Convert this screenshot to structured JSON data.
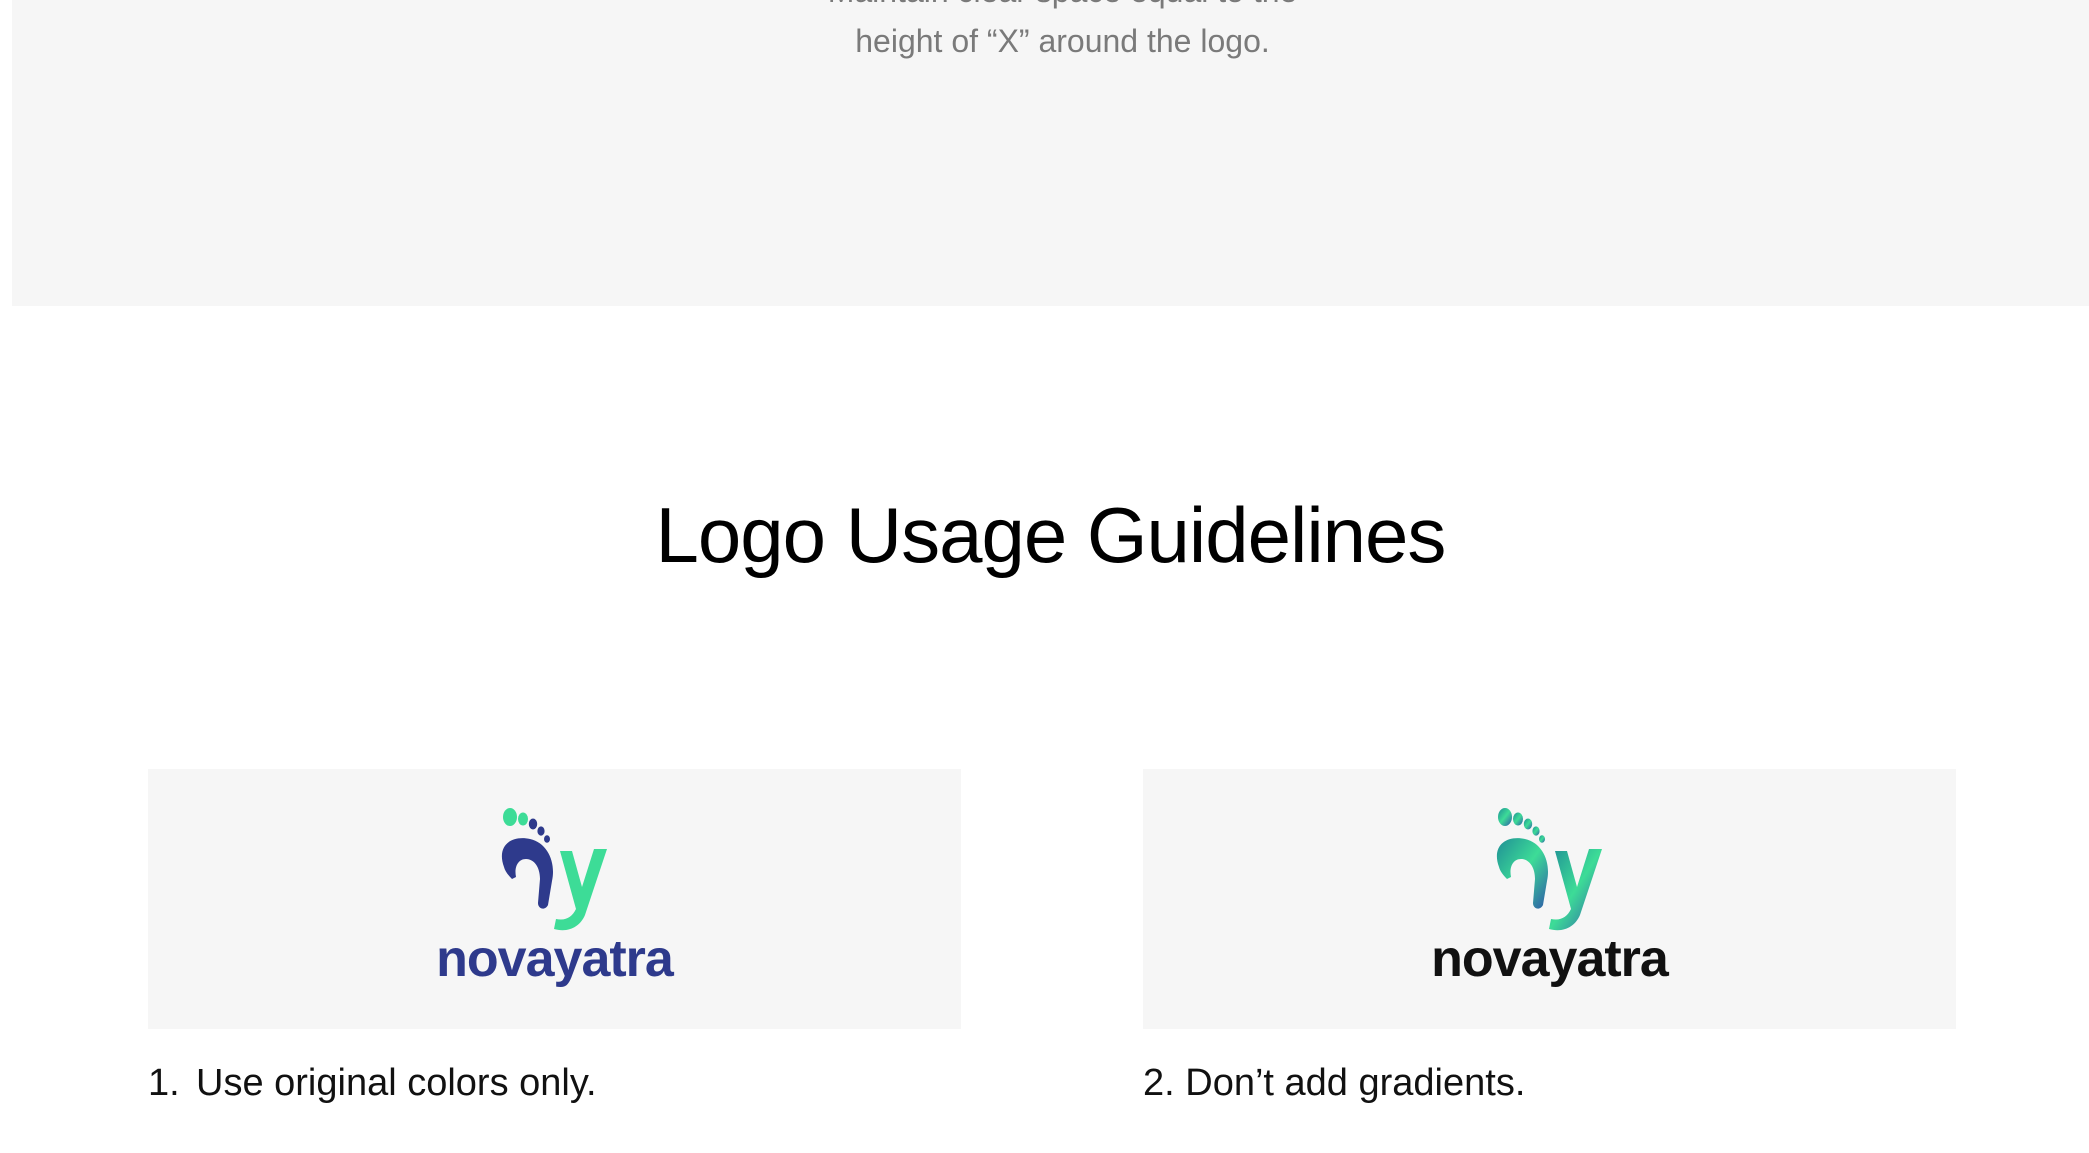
{
  "clear_space": {
    "caption_line1": "Maintain clear space equal to the",
    "caption_line2": "height of “X” around the logo."
  },
  "section": {
    "title": "Logo Usage Guidelines"
  },
  "logos": [
    {
      "wordmark": "novayatra",
      "wordmark_color": "#2e3a8c",
      "mark_colors": [
        "#2e3a8c",
        "#3ddc97"
      ]
    },
    {
      "wordmark": "novayatra",
      "wordmark_color": "#111111",
      "mark_colors": [
        "#2e3a8c",
        "#3ddc97"
      ]
    }
  ],
  "guidelines": [
    {
      "number": "1.",
      "text": "Use original colors only."
    },
    {
      "number": "2.",
      "text": "Don’t add gradients."
    }
  ]
}
